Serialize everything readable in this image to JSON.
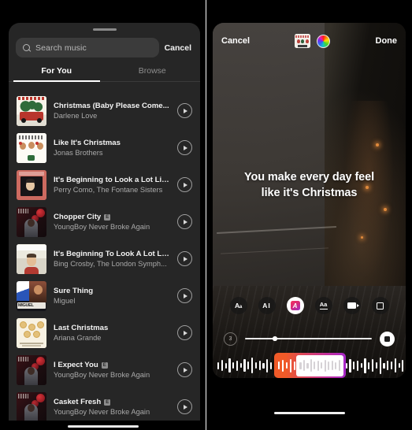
{
  "left_panel": {
    "name": "instagram-music-picker",
    "search": {
      "placeholder": "Search music",
      "value": "",
      "icon": "search-icon"
    },
    "cancel_label": "Cancel",
    "tabs": [
      {
        "label": "For You",
        "active": true
      },
      {
        "label": "Browse",
        "active": false
      }
    ],
    "songs": [
      {
        "title": "Christmas (Baby Please Come...",
        "artist": "Darlene Love",
        "explicit": false,
        "art": "christmas-truck",
        "play_icon": "play-icon"
      },
      {
        "title": "Like It's Christmas",
        "artist": "Jonas Brothers",
        "explicit": false,
        "art": "jonas-brothers",
        "play_icon": "play-icon"
      },
      {
        "title": "It's Beginning to Look a Lot Lik...",
        "artist": "Perry Como, The Fontane Sisters",
        "explicit": false,
        "art": "perry-como",
        "play_icon": "play-icon"
      },
      {
        "title": "Chopper City",
        "artist": "YoungBoy Never Broke Again",
        "explicit": true,
        "explicit_label": "E",
        "art": "youngboy-red",
        "play_icon": "play-icon"
      },
      {
        "title": "It's Beginning To Look A Lot Lik...",
        "artist": "Bing Crosby, The London Symph...",
        "explicit": false,
        "art": "bing-crosby",
        "play_icon": "play-icon"
      },
      {
        "title": "Sure Thing",
        "artist": "Miguel",
        "explicit": false,
        "art": "miguel",
        "play_icon": "play-icon"
      },
      {
        "title": "Last Christmas",
        "artist": "Ariana Grande",
        "explicit": false,
        "art": "ariana-grande",
        "play_icon": "play-icon"
      },
      {
        "title": "I Expect You",
        "artist": "YoungBoy Never Broke Again",
        "explicit": true,
        "explicit_label": "E",
        "art": "youngboy-red",
        "play_icon": "play-icon"
      },
      {
        "title": "Casket Fresh",
        "artist": "YoungBoy Never Broke Again",
        "explicit": true,
        "explicit_label": "E",
        "art": "youngboy-red",
        "play_icon": "play-icon"
      }
    ]
  },
  "right_panel": {
    "name": "instagram-story-editor",
    "top_bar": {
      "cancel_label": "Cancel",
      "done_label": "Done",
      "sticker_icon": "sticker-icon",
      "color_wheel_icon": "color-wheel-icon"
    },
    "caption": {
      "line1": "You make every day feel",
      "line2": "like it's Christmas"
    },
    "text_toolbar": [
      {
        "name": "font-size-button",
        "icon": "aa-icon",
        "label": "Aa",
        "active": false
      },
      {
        "name": "text-align-button",
        "icon": "ai-icon",
        "label": "AI",
        "active": false
      },
      {
        "name": "text-style-button",
        "icon": "a-gradient-icon",
        "label": "A",
        "active": true
      },
      {
        "name": "text-underline-button",
        "icon": "aa-underline-icon",
        "label": "Aa",
        "active": false
      },
      {
        "name": "text-animation-button",
        "icon": "video-icon",
        "label": "",
        "active": false
      },
      {
        "name": "text-background-button",
        "icon": "square-icon",
        "label": "",
        "active": false
      }
    ],
    "audio_controls": {
      "duration_label": "3",
      "slider_position_pct": 22,
      "record_icon": "stop-record-icon"
    },
    "waveform": {
      "selection_start_pct": 31,
      "selection_width_pct": 39,
      "gradient_start": "#f05a28",
      "gradient_end": "#a627c9"
    }
  },
  "colors": {
    "sheet_background": "#262626",
    "search_field": "#3b3b3b",
    "accent_white": "#ffffff",
    "muted_text": "#a9a9a9"
  }
}
